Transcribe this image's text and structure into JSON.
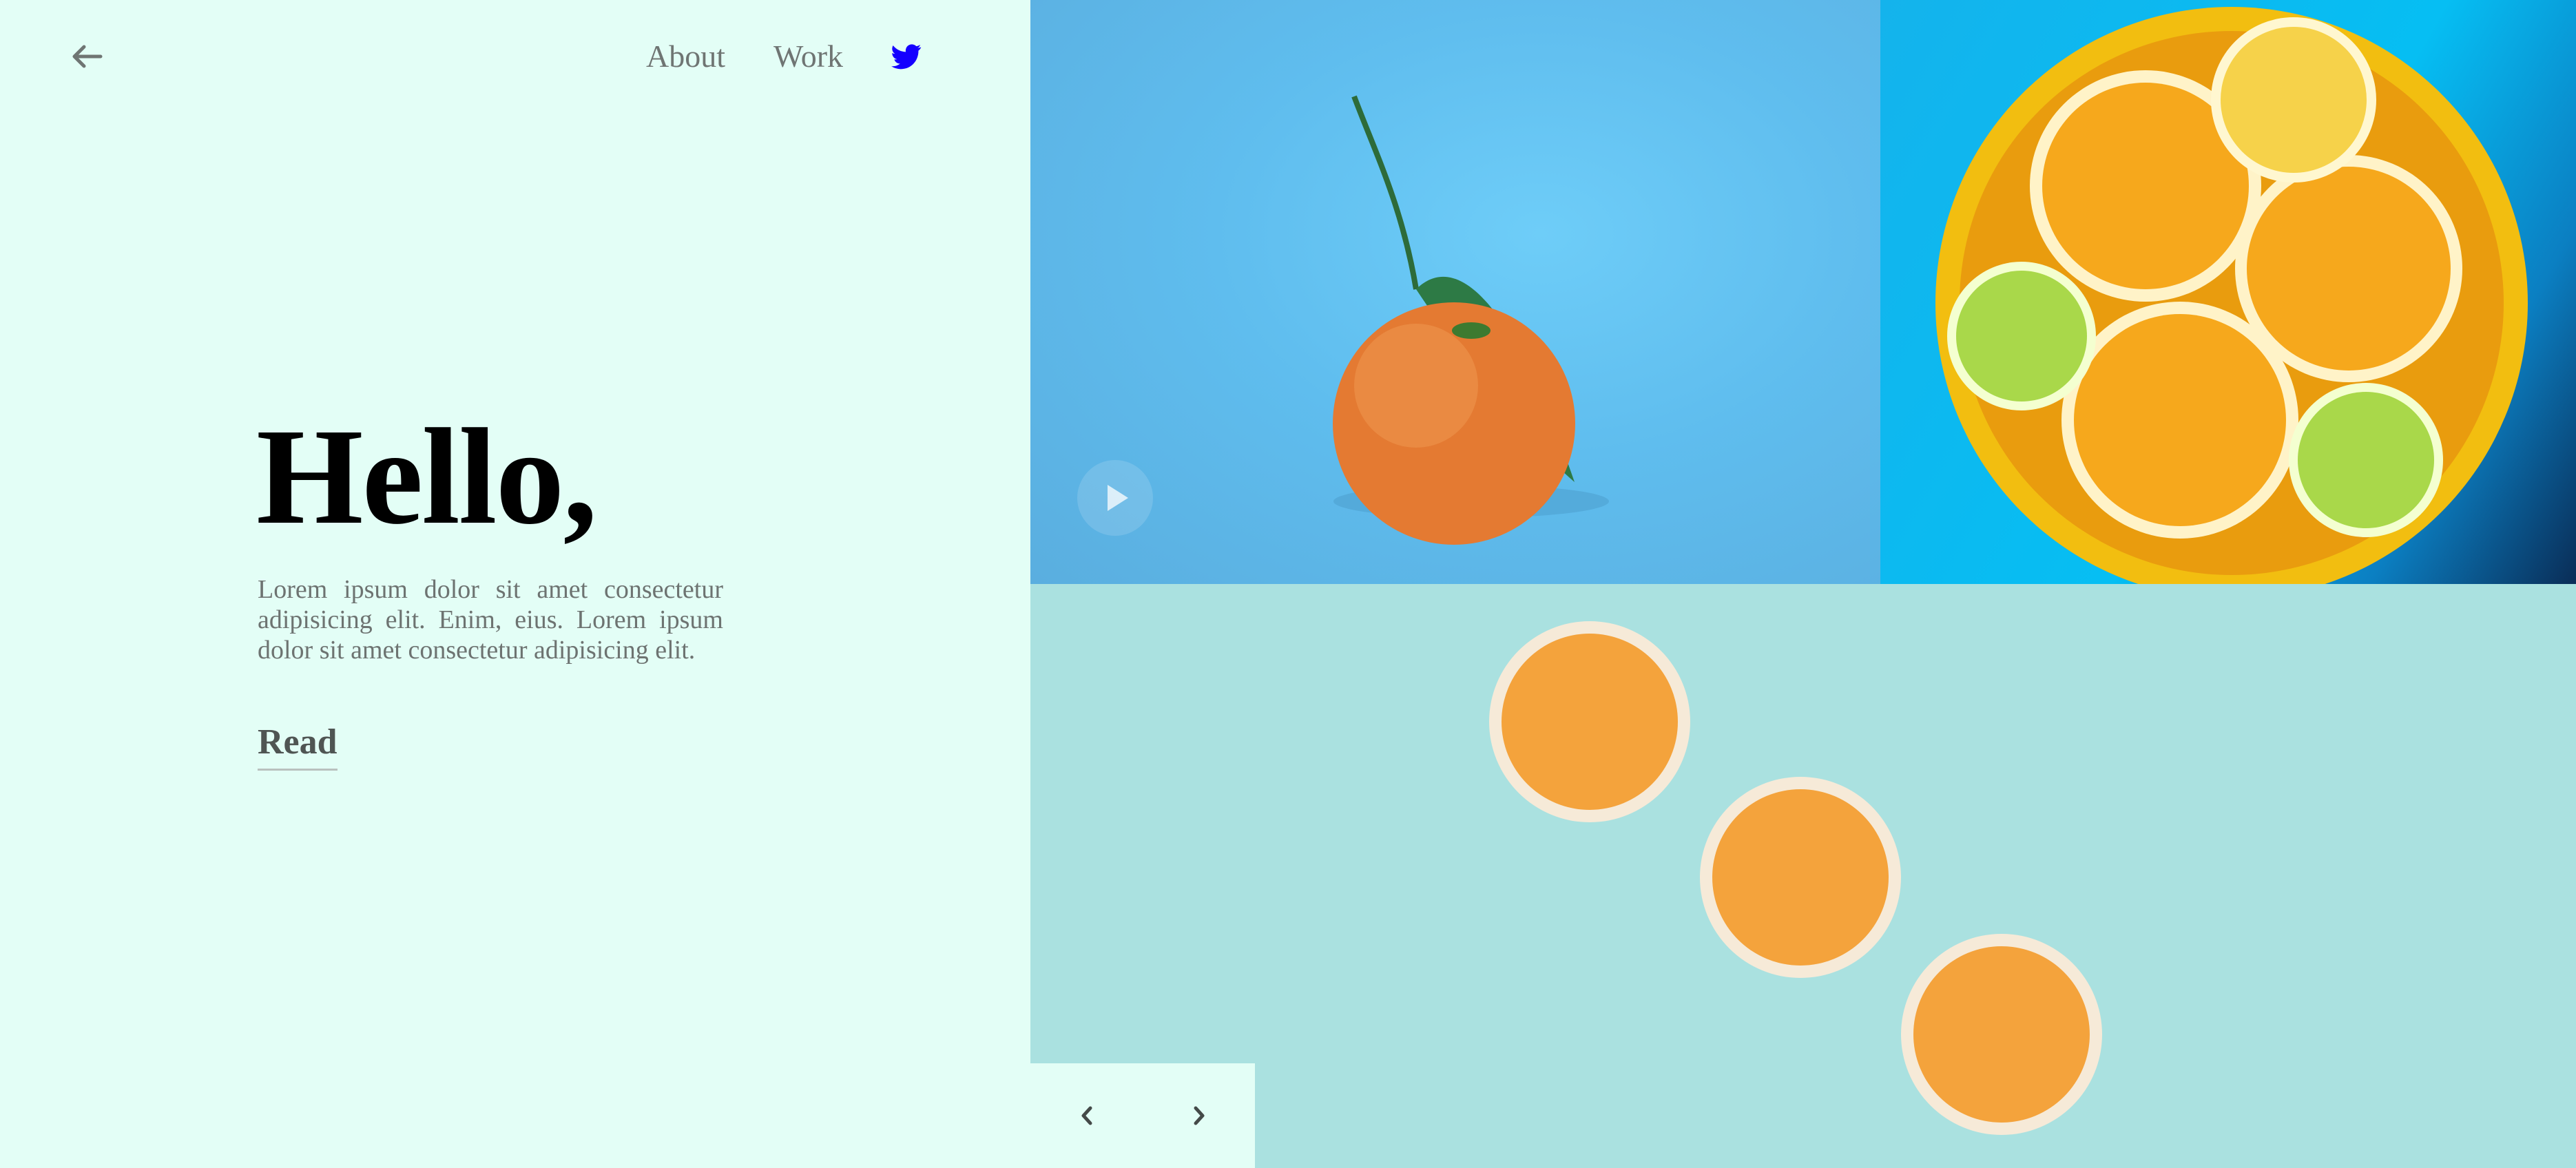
{
  "nav": {
    "back_icon": "arrow-left-icon",
    "links": [
      {
        "label": "About"
      },
      {
        "label": "Work"
      }
    ],
    "social_icon": "twitter-icon",
    "social_color": "#1500ff"
  },
  "hero": {
    "title": "Hello,",
    "body": "Lorem ipsum dolor sit amet consectetur adipisicing elit. Enim, eius. Lorem ipsum dolor sit amet consectetur adipisicing elit.",
    "read_label": "Read"
  },
  "gallery": {
    "play_icon": "play-icon",
    "prev_icon": "chevron-left-icon",
    "next_icon": "chevron-right-icon"
  },
  "colors": {
    "left_background": "#e3fef6",
    "slices_background": "#aae1e0",
    "orange_tile_background": "#5fbdee",
    "bowl_tile_background": "#06bef3"
  }
}
